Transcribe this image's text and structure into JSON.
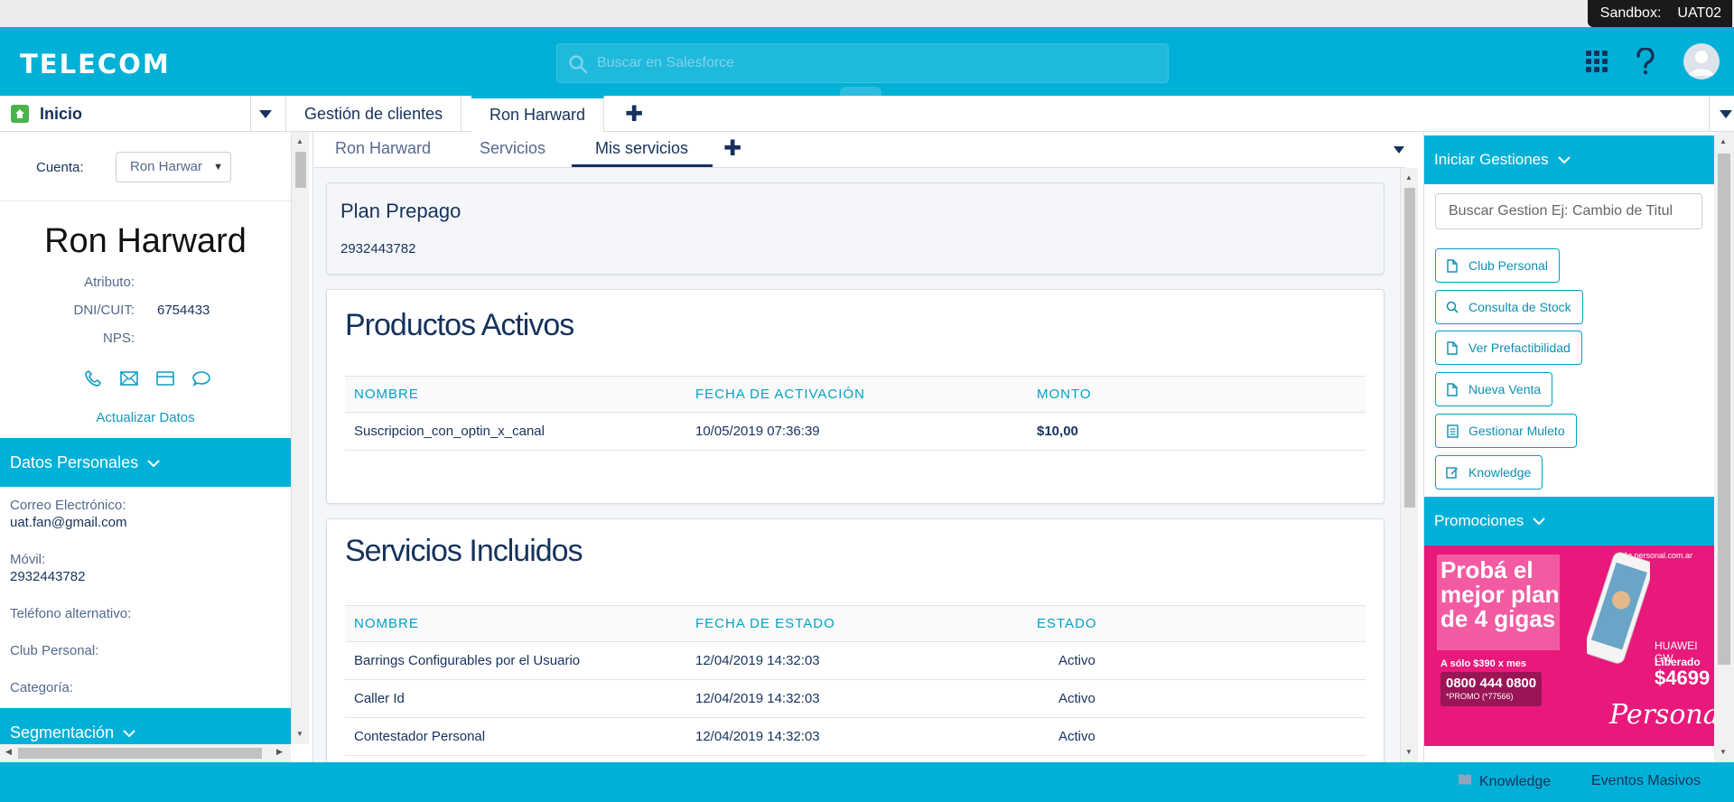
{
  "sandbox": {
    "label": "Sandbox:",
    "env": "UAT02"
  },
  "header": {
    "logo": "TELECOM",
    "search_placeholder": "Buscar en Salesforce"
  },
  "nav": {
    "home_label": "Inicio",
    "tabs": [
      {
        "label": "Gestión de clientes"
      },
      {
        "label": "Ron Harward"
      }
    ]
  },
  "left": {
    "cuenta_label": "Cuenta:",
    "cuenta_value": "Ron Harwar",
    "client_name": "Ron Harward",
    "attributes": [
      {
        "label": "Atributo:",
        "value": ""
      },
      {
        "label": "DNI/CUIT:",
        "value": "6754433"
      },
      {
        "label": "NPS:",
        "value": ""
      }
    ],
    "actualizar": "Actualizar Datos",
    "datos_personales": "Datos Personales",
    "fields": [
      {
        "label": "Correo Electrónico:",
        "value": "uat.fan@gmail.com"
      },
      {
        "label": "Móvil:",
        "value": "2932443782"
      },
      {
        "label": "Teléfono alternativo:",
        "value": ""
      },
      {
        "label": "Club Personal:",
        "value": ""
      },
      {
        "label": "Categoría:",
        "value": ""
      }
    ],
    "segmentacion": "Segmentación"
  },
  "center": {
    "subtabs": [
      "Ron Harward",
      "Servicios",
      "Mis servicios"
    ],
    "plan": {
      "title": "Plan Prepago",
      "number": "2932443782"
    },
    "productos": {
      "title": "Productos Activos",
      "headers": [
        "NOMBRE",
        "FECHA DE ACTIVACIÓN",
        "MONTO"
      ],
      "rows": [
        [
          "Suscripcion_con_optin_x_canal",
          "10/05/2019 07:36:39",
          "$10,00"
        ]
      ]
    },
    "servicios": {
      "title": "Servicios Incluidos",
      "headers": [
        "NOMBRE",
        "FECHA DE ESTADO",
        "ESTADO"
      ],
      "rows": [
        [
          "Barrings Configurables por el Usuario",
          "12/04/2019 14:32:03",
          "Activo"
        ],
        [
          "Caller Id",
          "12/04/2019 14:32:03",
          "Activo"
        ],
        [
          "Contestador Personal",
          "12/04/2019 14:32:03",
          "Activo"
        ]
      ]
    }
  },
  "right": {
    "iniciar": "Iniciar Gestiones",
    "search_placeholder": "Buscar Gestion Ej: Cambio de Titul",
    "buttons": [
      {
        "label": "Club Personal",
        "icon": "document-icon"
      },
      {
        "label": "Consulta de Stock",
        "icon": "search-icon"
      },
      {
        "label": "Ver Prefactibilidad",
        "icon": "document-icon"
      },
      {
        "label": "Nueva Venta",
        "icon": "document-icon"
      },
      {
        "label": "Gestionar Muleto",
        "icon": "form-icon"
      },
      {
        "label": "Knowledge",
        "icon": "edit-icon"
      }
    ],
    "promociones": "Promociones",
    "promo": {
      "headline": "Probá el mejor plan de 4 gigas",
      "price_line": "A sólo $390 x mes",
      "phone": "0800 444 0800",
      "code": "*PROMO (*77566)",
      "device": "HUAWEI GW",
      "liberado": "Liberado",
      "price": "$4699",
      "brand": "Personal",
      "top": "4g personal.com.ar"
    }
  },
  "footer": {
    "knowledge": "Knowledge",
    "eventos": "Eventos Masivos"
  },
  "colors": {
    "brand": "#00b0d7",
    "text": "#16325c",
    "promo": "#e8197a"
  }
}
